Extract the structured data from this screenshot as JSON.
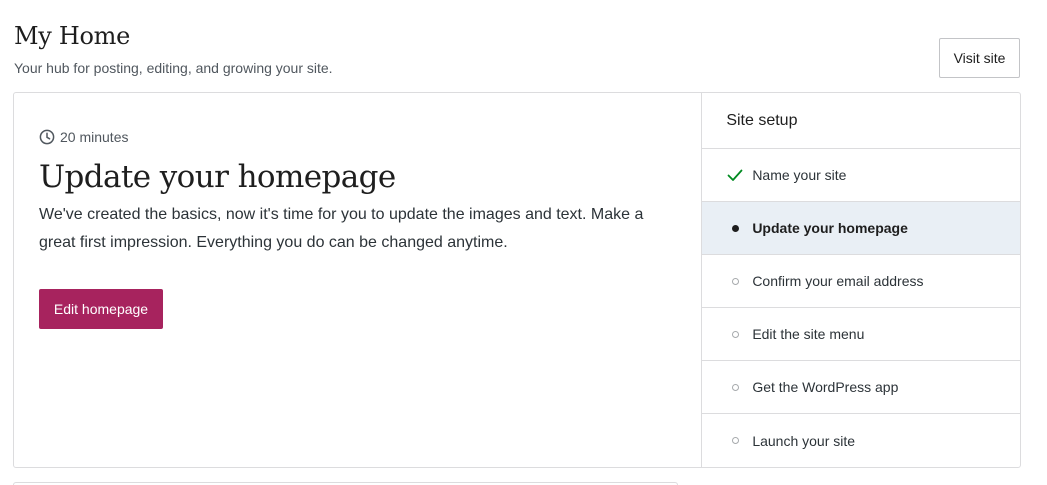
{
  "header": {
    "title": "My Home",
    "subtitle": "Your hub for posting, editing, and growing your site.",
    "visit_site_label": "Visit site"
  },
  "task": {
    "time_estimate": "20 minutes",
    "time_icon": "clock-icon",
    "title": "Update your homepage",
    "description": "We've created the basics, now it's time for you to update the images and text. Make a great first impression. Everything you do can be changed anytime.",
    "action_label": "Edit homepage"
  },
  "setup": {
    "title": "Site setup",
    "steps": [
      {
        "label": "Name your site",
        "status": "complete"
      },
      {
        "label": "Update your homepage",
        "status": "active"
      },
      {
        "label": "Confirm your email address",
        "status": "pending"
      },
      {
        "label": "Edit the site menu",
        "status": "pending"
      },
      {
        "label": "Get the WordPress app",
        "status": "pending"
      },
      {
        "label": "Launch your site",
        "status": "pending"
      }
    ]
  },
  "colors": {
    "primary_button": "#a7235e",
    "active_step_bg": "#e9eff5",
    "check": "#008a20"
  }
}
